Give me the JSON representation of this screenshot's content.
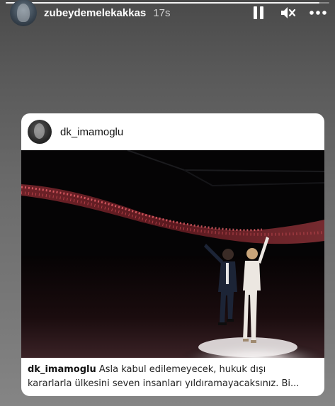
{
  "story": {
    "username": "zubeydemelekakkas",
    "time": "17s",
    "progress": 0.97
  },
  "icons": {
    "pause": "pause-icon",
    "mute": "speaker-muted-icon",
    "more": "more-horizontal-icon"
  },
  "post": {
    "username": "dk_imamoglu",
    "caption_user": "dk_imamoglu",
    "caption_line1": "Asla kabul edilemeyecek, hukuk dışı",
    "caption_line2": "kararlarla ülkesini seven insanları yıldıramayacaksınız. Bi..."
  }
}
